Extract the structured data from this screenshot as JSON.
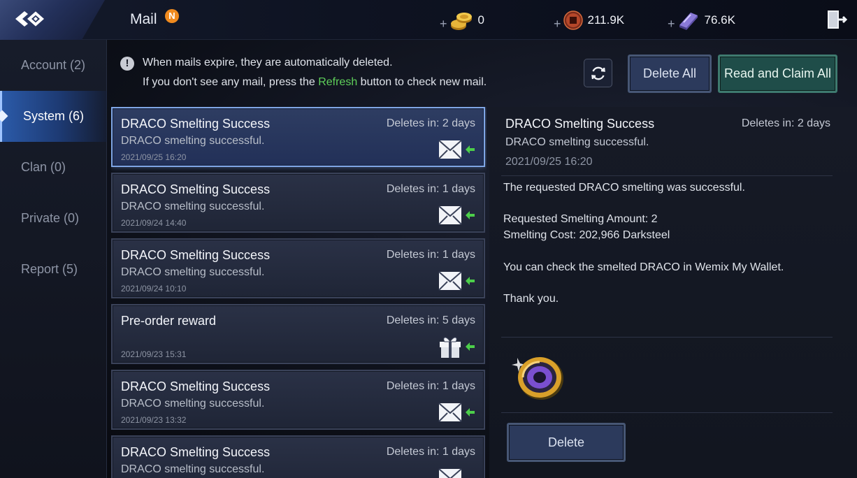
{
  "header": {
    "title": "Mail",
    "badge": "N",
    "currencies": [
      {
        "icon": "gold-coins-icon",
        "plus": "+",
        "value": "0"
      },
      {
        "icon": "darksteel-coin-icon",
        "plus": "+",
        "value": "211.9K"
      },
      {
        "icon": "crystal-ingot-icon",
        "plus": "+",
        "value": "76.6K"
      }
    ]
  },
  "sidebar": {
    "items": [
      {
        "label": "Account (2)",
        "active": false
      },
      {
        "label": "System (6)",
        "active": true
      },
      {
        "label": "Clan (0)",
        "active": false
      },
      {
        "label": "Private (0)",
        "active": false
      },
      {
        "label": "Report (5)",
        "active": false
      }
    ]
  },
  "notice": {
    "line1": "When mails expire, they are automatically deleted.",
    "line2_prefix": "If you don't see any mail, press the ",
    "line2_link": "Refresh",
    "line2_suffix": " button to check new mail."
  },
  "actions": {
    "delete_all": "Delete All",
    "read_claim_all": "Read and Claim All"
  },
  "mails": [
    {
      "title": "DRACO Smelting Success",
      "deletes": "Deletes in: 2 days",
      "sub": "DRACO smelting successful.",
      "date": "2021/09/25 16:20",
      "icon": "envelope-icon",
      "selected": true
    },
    {
      "title": "DRACO Smelting Success",
      "deletes": "Deletes in: 1 days",
      "sub": "DRACO smelting successful.",
      "date": "2021/09/24 14:40",
      "icon": "envelope-icon",
      "selected": false
    },
    {
      "title": "DRACO Smelting Success",
      "deletes": "Deletes in: 1 days",
      "sub": "DRACO smelting successful.",
      "date": "2021/09/24 10:10",
      "icon": "envelope-icon",
      "selected": false
    },
    {
      "title": "Pre-order reward",
      "deletes": "Deletes in: 5 days",
      "sub": "",
      "date": "2021/09/23 15:31",
      "icon": "gift-icon",
      "selected": false
    },
    {
      "title": "DRACO Smelting Success",
      "deletes": "Deletes in: 1 days",
      "sub": "DRACO smelting successful.",
      "date": "2021/09/23 13:32",
      "icon": "envelope-icon",
      "selected": false
    },
    {
      "title": "DRACO Smelting Success",
      "deletes": "Deletes in: 1 days",
      "sub": "DRACO smelting successful.",
      "date": "",
      "icon": "envelope-icon",
      "selected": false
    }
  ],
  "detail": {
    "title": "DRACO Smelting Success",
    "deletes": "Deletes in: 2 days",
    "sub": "DRACO smelting successful.",
    "date": "2021/09/25 16:20",
    "body": [
      "The requested DRACO smelting was successful.",
      "Requested Smelting Amount: 2",
      "Smelting Cost: 202,966 Darksteel",
      "You can check the smelted DRACO in Wemix My Wallet.",
      "Thank you."
    ],
    "reward_icon": "draco-coin-icon",
    "delete_label": "Delete"
  },
  "colors": {
    "accent_green": "#5fd05a",
    "badge_orange": "#f08a1e",
    "selected_border": "#7fa6e6"
  }
}
